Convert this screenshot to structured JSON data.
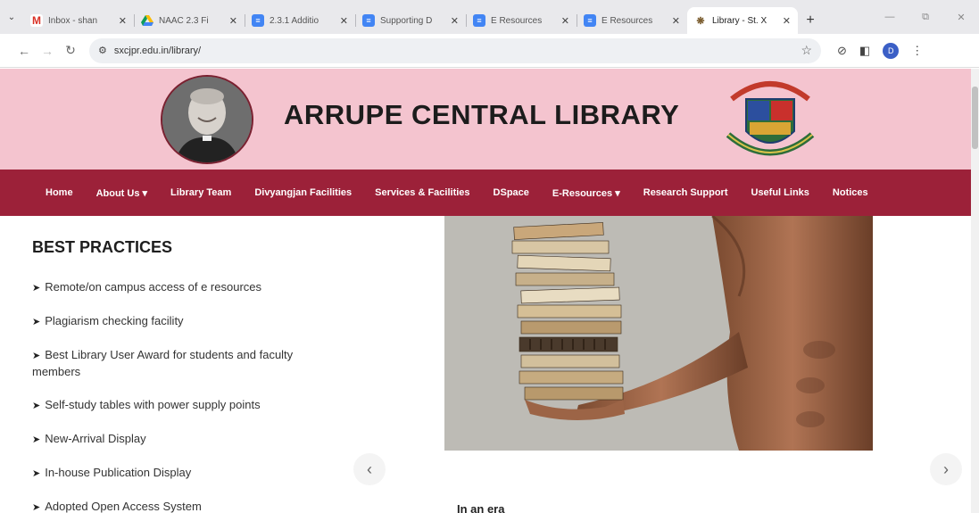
{
  "browser": {
    "tabs": [
      {
        "title": "Inbox - shan",
        "icon": "gmail-icon"
      },
      {
        "title": "NAAC 2.3 Fi",
        "icon": "drive-icon"
      },
      {
        "title": "2.3.1 Additio",
        "icon": "docs-icon"
      },
      {
        "title": "Supporting D",
        "icon": "docs-icon"
      },
      {
        "title": "E Resources",
        "icon": "docs-icon"
      },
      {
        "title": "E Resources",
        "icon": "docs-icon"
      },
      {
        "title": "Library - St. X",
        "icon": "library-favicon-icon",
        "active": true
      }
    ],
    "url": "sxcjpr.edu.in/library/",
    "profile_initial": "D"
  },
  "site": {
    "title": "ARRUPE CENTRAL LIBRARY",
    "nav": [
      {
        "label": "Home"
      },
      {
        "label": "About Us ▾"
      },
      {
        "label": "Library Team"
      },
      {
        "label": "Divyangjan Facilities"
      },
      {
        "label": "Services & Facilities"
      },
      {
        "label": "DSpace"
      },
      {
        "label": "E-Resources ▾"
      },
      {
        "label": "Research Support"
      },
      {
        "label": "Useful Links"
      },
      {
        "label": "Notices"
      }
    ],
    "colors": {
      "header_bg": "#f4c4cf",
      "nav_bg": "#9c2139"
    }
  },
  "best_practices": {
    "heading": "BEST PRACTICES",
    "items": [
      "Remote/on campus access of e resources",
      "Plagiarism checking facility",
      "Best Library User Award for students and faculty members",
      "Self-study tables with power supply points",
      "New-Arrival Display",
      "In-house Publication Display",
      "Adopted Open Access System"
    ]
  },
  "carousel": {
    "prev": "‹",
    "next": "›",
    "caption": "In an era"
  }
}
